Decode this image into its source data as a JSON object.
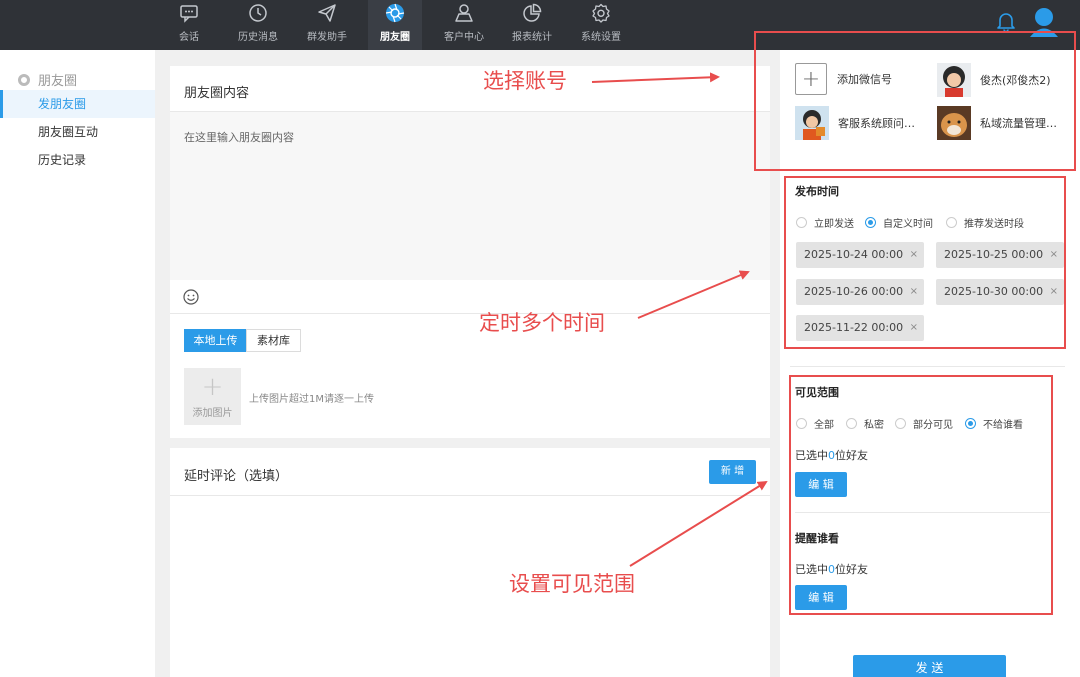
{
  "nav": {
    "items": [
      {
        "label": "会话",
        "icon": "chat-icon"
      },
      {
        "label": "历史消息",
        "icon": "clock-icon"
      },
      {
        "label": "群发助手",
        "icon": "send-icon"
      },
      {
        "label": "朋友圈",
        "icon": "aperture-icon"
      },
      {
        "label": "客户中心",
        "icon": "user-icon"
      },
      {
        "label": "报表统计",
        "icon": "pie-icon"
      },
      {
        "label": "系统设置",
        "icon": "gear-icon"
      }
    ],
    "active_index": 3
  },
  "sidebar": {
    "title": "朋友圈",
    "items": [
      {
        "label": "发朋友圈"
      },
      {
        "label": "朋友圈互动"
      },
      {
        "label": "历史记录"
      }
    ]
  },
  "compose": {
    "title": "朋友圈内容",
    "placeholder": "在这里输入朋友圈内容",
    "tab_local": "本地上传",
    "tab_library": "素材库",
    "add_image": "添加图片",
    "upload_hint": "上传图片超过1M请逐一上传"
  },
  "comment": {
    "title": "延时评论（选填）",
    "add_button": "新 增"
  },
  "accounts": {
    "add_label": "添加微信号",
    "items": [
      {
        "name": "俊杰(邓俊杰2)"
      },
      {
        "name": "客服系统顾问…"
      },
      {
        "name": "私域流量管理…"
      }
    ]
  },
  "publish_time": {
    "title": "发布时间",
    "options": [
      "立即发送",
      "自定义时间",
      "推荐发送时段"
    ],
    "selected": 1,
    "times": [
      "2025-10-24 00:00",
      "2025-10-25 00:00",
      "2025-10-26 00:00",
      "2025-10-30 00:00",
      "2025-11-22 00:00"
    ],
    "remove_glyph": "×"
  },
  "visibility": {
    "title": "可见范围",
    "options": [
      "全部",
      "私密",
      "部分可见",
      "不给谁看"
    ],
    "selected": 3,
    "selected_prefix": "已选中",
    "selected_count": "0",
    "selected_suffix": "位好友",
    "edit_label": "编 辑"
  },
  "remind": {
    "title": "提醒谁看",
    "selected_prefix": "已选中",
    "selected_count": "0",
    "selected_suffix": "位好友",
    "edit_label": "编 辑"
  },
  "send_label": "发 送",
  "annotations": {
    "account": "选择账号",
    "times": "定时多个时间",
    "visibility": "设置可见范围",
    "color": "#e84d4d"
  },
  "colors": {
    "accent": "#2b9be8",
    "topbar": "#2f3237"
  }
}
